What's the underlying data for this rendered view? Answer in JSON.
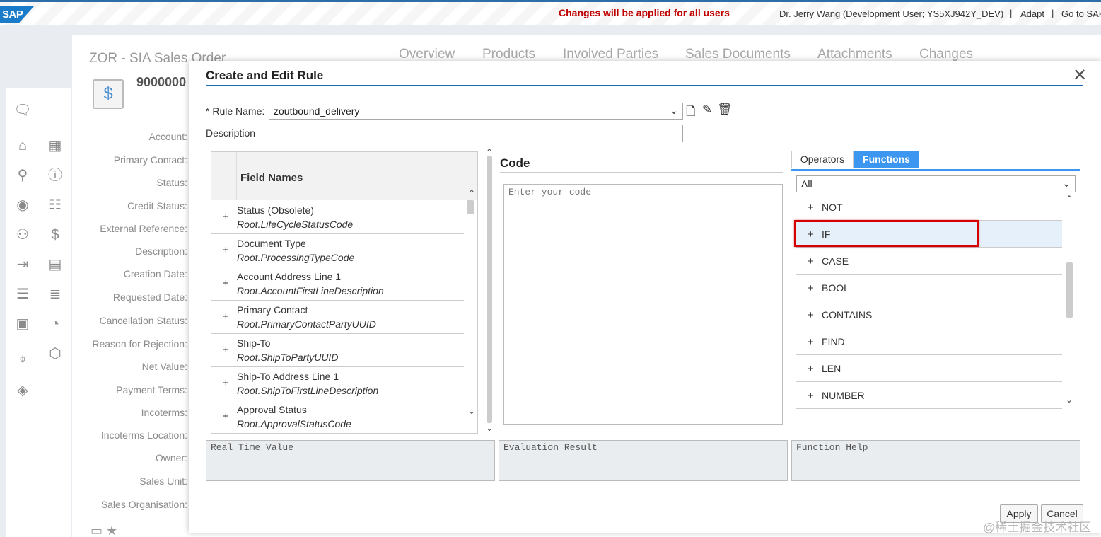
{
  "shell": {
    "logo": "SAP",
    "changes_note": "Changes will be applied for all users",
    "user": "Dr. Jerry Wang (Development User; YS5XJ942Y_DEV)",
    "adapt": "Adapt",
    "go_to": "Go to SAP"
  },
  "background": {
    "title": "ZOR - SIA Sales Order",
    "doc_id": "9000000",
    "tabs": [
      "Overview",
      "Products",
      "Involved Parties",
      "Sales Documents",
      "Attachments",
      "Changes"
    ],
    "labels": [
      "Account:",
      "Primary Contact:",
      "Status:",
      "Credit Status:",
      "External Reference:",
      "Description:",
      "Creation Date:",
      "Requested Date:",
      "Cancellation Status:",
      "Reason for Rejection:",
      "Net Value:",
      "Payment Terms:",
      "Incoterms:",
      "Incoterms Location:",
      "Owner:",
      "Sales Unit:",
      "Sales Organisation:"
    ]
  },
  "dialog": {
    "title": "Create and Edit Rule",
    "close": "✕",
    "rule_name_label": "* Rule Name:",
    "rule_name_value": "zoutbound_delivery",
    "description_label": "Description",
    "description_value": "",
    "field_names_header": "Field Names",
    "fields": [
      {
        "name": "Status (Obsolete)",
        "path": "Root.LifeCycleStatusCode"
      },
      {
        "name": "Document Type",
        "path": "Root.ProcessingTypeCode"
      },
      {
        "name": "Account Address Line 1",
        "path": "Root.AccountFirstLineDescription"
      },
      {
        "name": "Primary Contact",
        "path": "Root.PrimaryContactPartyUUID"
      },
      {
        "name": "Ship-To",
        "path": "Root.ShipToPartyUUID"
      },
      {
        "name": "Ship-To Address Line 1",
        "path": "Root.ShipToFirstLineDescription"
      },
      {
        "name": "Approval Status",
        "path": "Root.ApprovalStatusCode"
      }
    ],
    "code_title": "Code",
    "code_placeholder": "Enter your code",
    "tabs": {
      "operators": "Operators",
      "functions": "Functions",
      "active": "Functions"
    },
    "function_filter": "All",
    "functions": [
      "NOT",
      "IF",
      "CASE",
      "BOOL",
      "CONTAINS",
      "FIND",
      "LEN",
      "NUMBER"
    ],
    "selected_function": "IF",
    "panels": {
      "real_time": "Real Time Value",
      "evaluation": "Evaluation Result",
      "help": "Function Help"
    },
    "apply": "Apply",
    "cancel": "Cancel"
  },
  "watermark": "@稀土掘金技术社区",
  "colors": {
    "accent": "#3d97f0",
    "highlight": "#d40000",
    "notice": "#c00000"
  }
}
